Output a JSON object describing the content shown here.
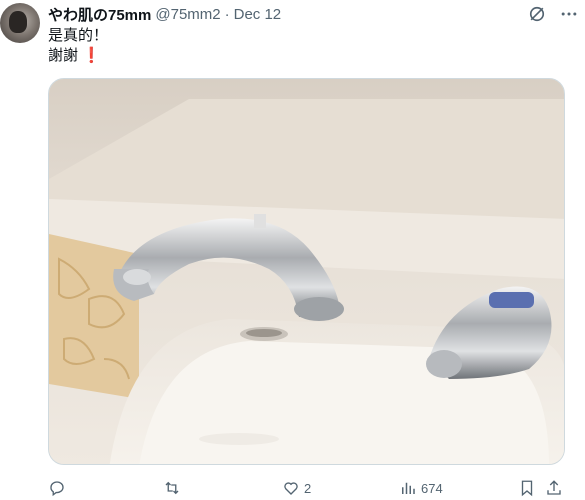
{
  "tweet": {
    "author_name": "やわ肌の75mm",
    "handle": "@75mm2",
    "separator": "·",
    "date": "Dec 12",
    "text_line1": "是真的！",
    "text_line2": "謝謝 ❗",
    "media_alt_icon": "photo-of-sink-faucets"
  },
  "actions": {
    "reply_count": "",
    "retweet_count": "",
    "like_count": "2",
    "views_count": "674"
  },
  "icons": {
    "reply": "reply-icon",
    "retweet": "retweet-icon",
    "like": "heart-icon",
    "views": "views-icon",
    "bookmark": "bookmark-icon",
    "share": "share-icon",
    "grok": "grok-icon",
    "more": "more-icon"
  },
  "colors": {
    "text_secondary": "#536471",
    "text_primary": "#0f1419",
    "exclamation": "#d0021b"
  }
}
